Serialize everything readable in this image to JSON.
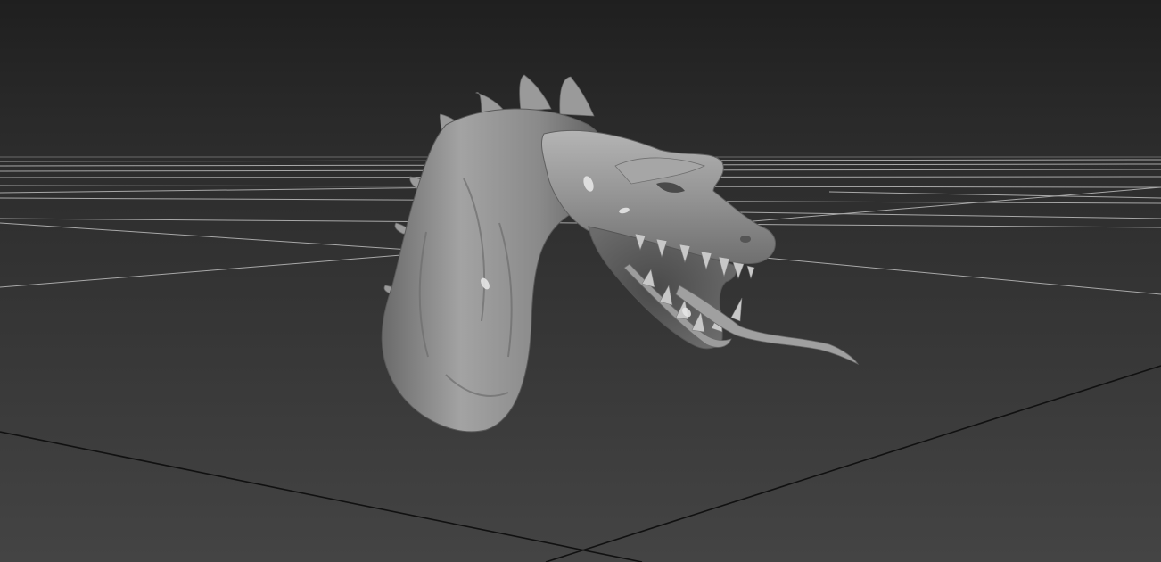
{
  "viewport": {
    "shading_mode": "smooth-shaded",
    "background_top": "#1f1f1f",
    "background_bottom": "#444444",
    "grid_line_color": "#bdbdbd",
    "grid_axis_color": "#111111"
  },
  "model": {
    "subject": "dragon-head",
    "material_color": "#8f8f8f"
  }
}
